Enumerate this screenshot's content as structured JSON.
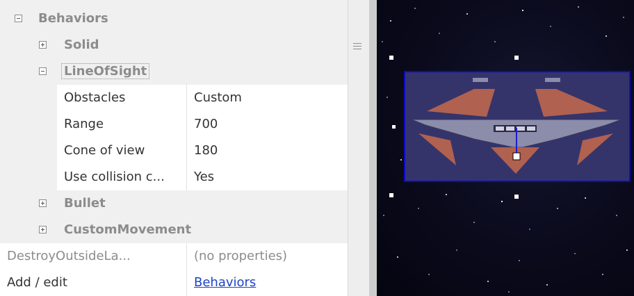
{
  "properties": {
    "categories": [
      {
        "id": "behaviors",
        "label": "Behaviors",
        "expanded": true
      },
      {
        "id": "solid",
        "label": "Solid",
        "expanded": false
      },
      {
        "id": "lineofsight",
        "label": "LineOfSight",
        "expanded": true,
        "selected": true
      },
      {
        "id": "bullet",
        "label": "Bullet",
        "expanded": false
      },
      {
        "id": "custommovement",
        "label": "CustomMovement",
        "expanded": false
      }
    ],
    "lineofsight_props": [
      {
        "name": "Obstacles",
        "value": "Custom"
      },
      {
        "name": "Range",
        "value": "700"
      },
      {
        "name": "Cone of view",
        "value": "180"
      },
      {
        "name": "Use collision c...",
        "value": "Yes"
      }
    ],
    "destroy_outside": {
      "name": "DestroyOutsideLa...",
      "value": "(no properties)"
    },
    "add_edit": {
      "name": "Add / edit",
      "link": "Behaviors"
    }
  },
  "colors": {
    "category_text": "#8c8c8c",
    "link": "#1c44c8",
    "selection_box": "#0a0acc",
    "ship_hull": "#57577a",
    "ship_accent": "#b0614f",
    "space_bg": "#0a0a1c"
  },
  "icons": {
    "expanded": "minus-toggle-icon",
    "collapsed": "plus-toggle-icon",
    "splitter": "grip-lines-icon"
  }
}
